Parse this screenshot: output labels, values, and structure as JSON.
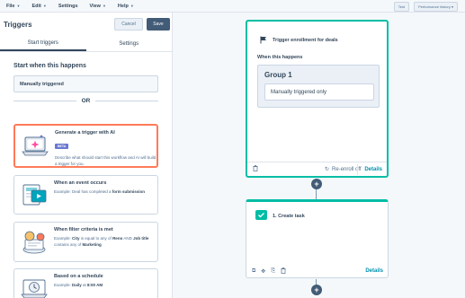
{
  "menubar": {
    "items": [
      {
        "label": "File"
      },
      {
        "label": "Edit"
      },
      {
        "label": "Settings"
      },
      {
        "label": "View"
      },
      {
        "label": "Help"
      }
    ],
    "right": [
      {
        "label": "Test"
      },
      {
        "label": "Performance history"
      }
    ]
  },
  "panel": {
    "title": "Triggers",
    "cancel_label": "Cancel",
    "save_label": "Save",
    "tabs": [
      {
        "label": "Start triggers",
        "active": true
      },
      {
        "label": "Settings",
        "active": false
      }
    ],
    "section_title": "Start when this happens",
    "trigger_value": "Manually triggered",
    "or_label": "OR",
    "cards": {
      "ai": {
        "title": "Generate a trigger with AI",
        "badge": "BETA",
        "desc": "Describe what should start this workflow and AI will build a trigger for you."
      },
      "event": {
        "title": "When an event occurs",
        "desc_prefix": "Example: Deal has completed a ",
        "desc_bold": "form submission"
      },
      "filter": {
        "title": "When filter criteria is met",
        "desc_1": "Example: ",
        "desc_b1": "City",
        "desc_2": " is equal to any of ",
        "desc_b2": "Reno",
        "desc_3": " AND ",
        "desc_b3": "Job title",
        "desc_4": " contains any of ",
        "desc_b4": "Marketing"
      },
      "schedule": {
        "title": "Based on a schedule",
        "desc_prefix": "Example: ",
        "desc_bold": "Daily",
        "desc_mid": " at ",
        "desc_bold2": "8:00 AM"
      }
    }
  },
  "canvas": {
    "enroll": {
      "title": "Trigger enrollment for deals",
      "when_label": "When this happens",
      "group_title": "Group 1",
      "group_value": "Manually triggered only",
      "reenroll_label": "Re-enroll off",
      "details_label": "Details"
    },
    "task": {
      "title": "1. Create task",
      "details_label": "Details"
    },
    "plus_label": "+"
  },
  "colors": {
    "accent_orange": "#ff7a59",
    "accent_teal": "#00bda5",
    "link": "#0091ae",
    "dark_button": "#425b76",
    "beta": "#6a78d1"
  }
}
